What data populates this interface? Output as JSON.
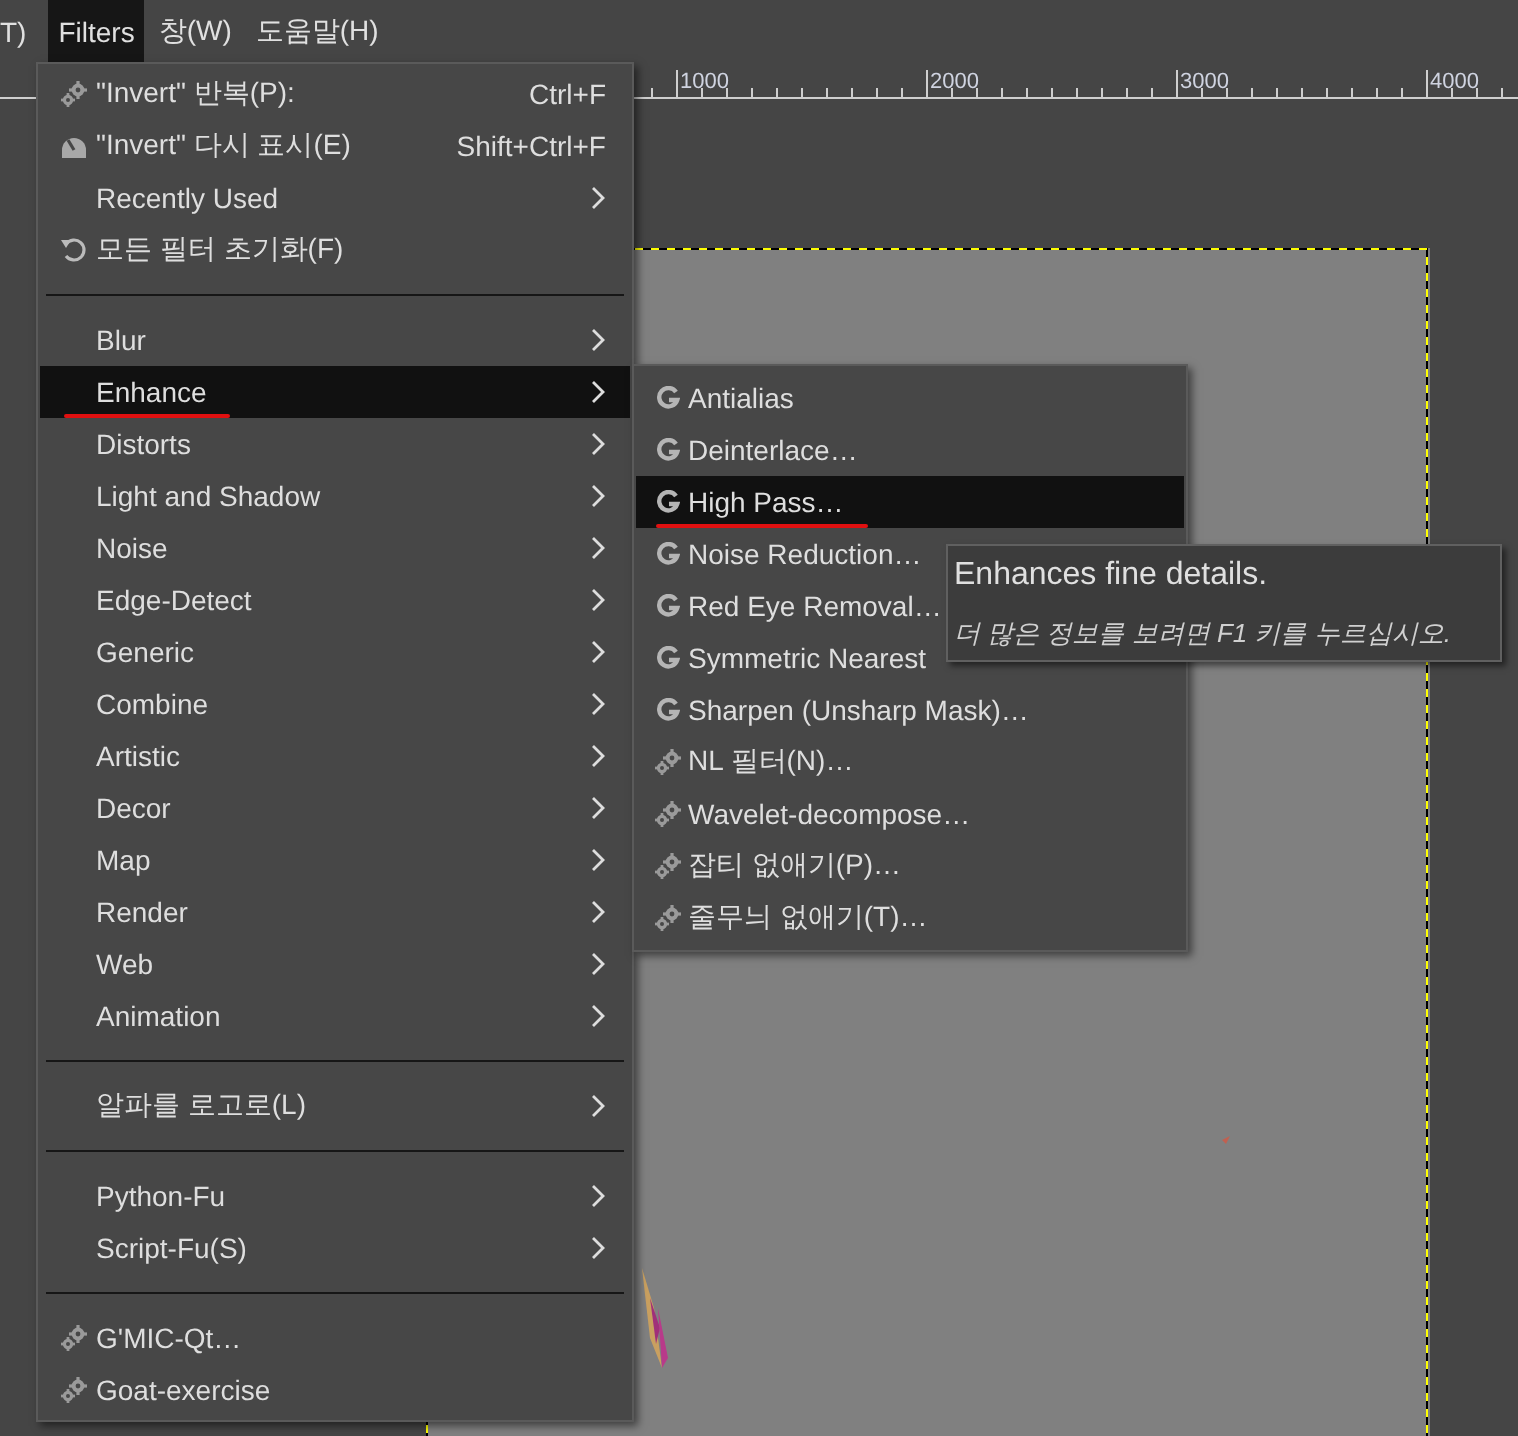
{
  "menubar": [
    {
      "label": "T)",
      "selected": false
    },
    {
      "label": "Filters",
      "selected": true
    },
    {
      "label": "창(W)",
      "selected": false
    },
    {
      "label": "도움말(H)",
      "selected": false
    }
  ],
  "ruler": {
    "labels": [
      "1000",
      "2000",
      "3000",
      "4000"
    ]
  },
  "filters_menu": [
    {
      "kind": "gear",
      "label": "\"Invert\" 반복(P):",
      "shortcut": "Ctrl+F",
      "submenu": false,
      "selected": false,
      "annotated": false
    },
    {
      "kind": "dial",
      "label": "\"Invert\" 다시 표시(E)",
      "shortcut": "Shift+Ctrl+F",
      "submenu": false,
      "selected": false,
      "annotated": false
    },
    {
      "kind": "item",
      "label": "Recently Used",
      "submenu": true,
      "selected": false,
      "annotated": false
    },
    {
      "kind": "reset",
      "label": "모든 필터 초기화(F)",
      "submenu": false,
      "selected": false,
      "annotated": false
    },
    {
      "kind": "separator"
    },
    {
      "kind": "item",
      "label": "Blur",
      "submenu": true,
      "selected": false,
      "annotated": false
    },
    {
      "kind": "item",
      "label": "Enhance",
      "submenu": true,
      "selected": true,
      "annotated": true
    },
    {
      "kind": "item",
      "label": "Distorts",
      "submenu": true,
      "selected": false,
      "annotated": false
    },
    {
      "kind": "item",
      "label": "Light and Shadow",
      "submenu": true,
      "selected": false,
      "annotated": false
    },
    {
      "kind": "item",
      "label": "Noise",
      "submenu": true,
      "selected": false,
      "annotated": false
    },
    {
      "kind": "item",
      "label": "Edge-Detect",
      "submenu": true,
      "selected": false,
      "annotated": false
    },
    {
      "kind": "item",
      "label": "Generic",
      "submenu": true,
      "selected": false,
      "annotated": false
    },
    {
      "kind": "item",
      "label": "Combine",
      "submenu": true,
      "selected": false,
      "annotated": false
    },
    {
      "kind": "item",
      "label": "Artistic",
      "submenu": true,
      "selected": false,
      "annotated": false
    },
    {
      "kind": "item",
      "label": "Decor",
      "submenu": true,
      "selected": false,
      "annotated": false
    },
    {
      "kind": "item",
      "label": "Map",
      "submenu": true,
      "selected": false,
      "annotated": false
    },
    {
      "kind": "item",
      "label": "Render",
      "submenu": true,
      "selected": false,
      "annotated": false
    },
    {
      "kind": "item",
      "label": "Web",
      "submenu": true,
      "selected": false,
      "annotated": false
    },
    {
      "kind": "item",
      "label": "Animation",
      "submenu": true,
      "selected": false,
      "annotated": false
    },
    {
      "kind": "separator"
    },
    {
      "kind": "item",
      "label": "알파를 로고로(L)",
      "submenu": true,
      "selected": false,
      "annotated": false
    },
    {
      "kind": "separator"
    },
    {
      "kind": "item",
      "label": "Python-Fu",
      "submenu": true,
      "selected": false,
      "annotated": false
    },
    {
      "kind": "item",
      "label": "Script-Fu(S)",
      "submenu": true,
      "selected": false,
      "annotated": false
    },
    {
      "kind": "separator"
    },
    {
      "kind": "gear",
      "label": "G'MIC-Qt…",
      "submenu": false,
      "selected": false,
      "annotated": false
    },
    {
      "kind": "gear",
      "label": "Goat-exercise",
      "submenu": false,
      "selected": false,
      "annotated": false
    }
  ],
  "enhance_submenu": [
    {
      "kind": "gegl",
      "label": "Antialias",
      "selected": false,
      "annotated": false
    },
    {
      "kind": "gegl",
      "label": "Deinterlace…",
      "selected": false,
      "annotated": false
    },
    {
      "kind": "gegl",
      "label": "High Pass…",
      "selected": true,
      "annotated": true
    },
    {
      "kind": "gegl",
      "label": "Noise Reduction…",
      "selected": false,
      "annotated": false
    },
    {
      "kind": "gegl",
      "label": "Red Eye Removal…",
      "selected": false,
      "annotated": false
    },
    {
      "kind": "gegl",
      "label": "Symmetric Nearest",
      "selected": false,
      "annotated": false
    },
    {
      "kind": "gegl",
      "label": "Sharpen (Unsharp Mask)…",
      "selected": false,
      "annotated": false
    },
    {
      "kind": "gear",
      "label": "NL 필터(N)…",
      "selected": false,
      "annotated": false
    },
    {
      "kind": "gear",
      "label": "Wavelet-decompose…",
      "selected": false,
      "annotated": false
    },
    {
      "kind": "gear",
      "label": "잡티 없애기(P)…",
      "selected": false,
      "annotated": false
    },
    {
      "kind": "gear",
      "label": "줄무늬 없애기(T)…",
      "selected": false,
      "annotated": false
    }
  ],
  "tooltip": {
    "text": "Enhances fine details.",
    "hint": "더 많은 정보를 보려면 F1 키를 누르십시오."
  }
}
